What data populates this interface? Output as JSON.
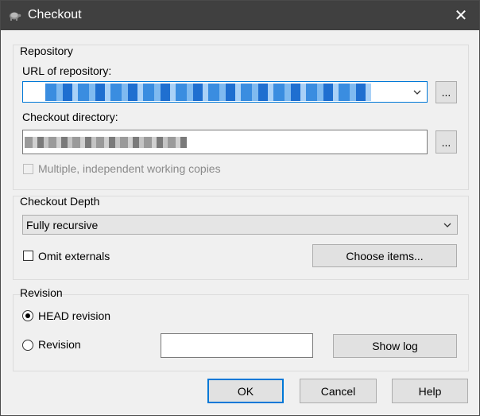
{
  "window": {
    "title": "Checkout",
    "close_glyph": "✕"
  },
  "repository": {
    "legend": "Repository",
    "url_label": "URL of repository:",
    "url_value": "",
    "url_browse": "...",
    "dir_label": "Checkout directory:",
    "dir_value": "",
    "dir_browse": "...",
    "multiple_label": "Multiple, independent working copies",
    "multiple_checked": false
  },
  "depth": {
    "legend": "Checkout Depth",
    "selected": "Fully recursive",
    "omit_label": "Omit externals",
    "omit_checked": false,
    "choose_items": "Choose items..."
  },
  "revision": {
    "legend": "Revision",
    "head_label": "HEAD revision",
    "head_selected": true,
    "rev_label": "Revision",
    "rev_value": "",
    "show_log": "Show log"
  },
  "buttons": {
    "ok": "OK",
    "cancel": "Cancel",
    "help": "Help"
  },
  "colors": {
    "titlebar": "#404040",
    "accent": "#0078d7",
    "dialog_bg": "#f0f0f0"
  },
  "icons": {
    "app": "tortoise-icon",
    "close": "close-icon",
    "chevron": "chevron-down-icon"
  }
}
